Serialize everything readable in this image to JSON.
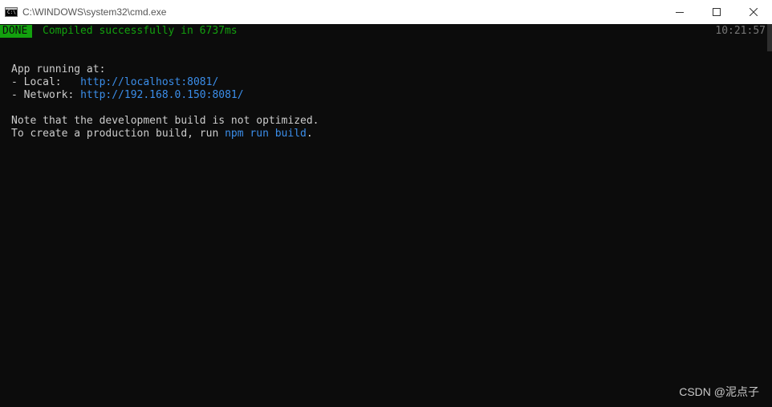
{
  "window": {
    "title": "C:\\WINDOWS\\system32\\cmd.exe",
    "icon": "cmd-console-icon",
    "icon_glyph": "C:\\",
    "controls": {
      "minimize_icon": "minimize-icon",
      "maximize_icon": "maximize-icon",
      "close_icon": "close-icon"
    }
  },
  "console": {
    "status_badge": "DONE",
    "compiled_message": "Compiled successfully in 6737ms",
    "timestamp": "10:21:57",
    "app_running_header": "App running at:",
    "local_label": "- Local:   ",
    "local_url": "http://localhost:8081/",
    "network_label": "- Network: ",
    "network_url": "http://192.168.0.150:8081/",
    "note_line": "Note that the development build is not optimized.",
    "production_prefix": "To create a production build, run ",
    "production_command": "npm run build",
    "production_suffix": "."
  },
  "watermark": "CSDN @泥点子",
  "colors": {
    "background": "#0c0c0c",
    "text": "#cccccc",
    "success_green": "#13a10e",
    "link_blue": "#3b8eea",
    "timestamp_gray": "#767676"
  }
}
